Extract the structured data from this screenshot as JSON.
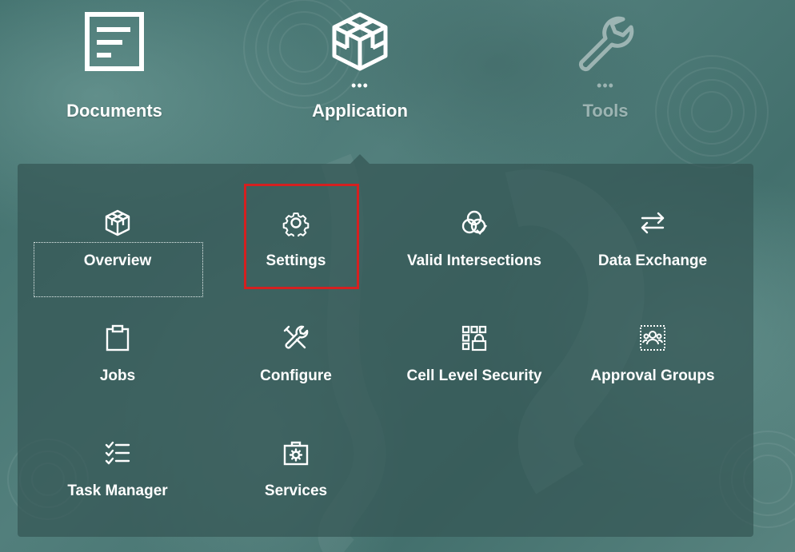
{
  "topnav": [
    {
      "label": "Documents",
      "icon": "document-icon",
      "has_more": false
    },
    {
      "label": "Application",
      "icon": "cube-icon",
      "has_more": true,
      "dots": "•••"
    },
    {
      "label": "Tools",
      "icon": "wrench-icon",
      "has_more": true,
      "dots": "•••"
    }
  ],
  "panel": {
    "tiles": [
      {
        "label": "Overview",
        "icon": "cube-icon"
      },
      {
        "label": "Settings",
        "icon": "gear-icon"
      },
      {
        "label": "Valid Intersections",
        "icon": "intersections-icon"
      },
      {
        "label": "Data Exchange",
        "icon": "exchange-arrows-icon"
      },
      {
        "label": "Jobs",
        "icon": "clipboard-icon"
      },
      {
        "label": "Configure",
        "icon": "tools-icon"
      },
      {
        "label": "Cell Level Security",
        "icon": "cell-security-icon"
      },
      {
        "label": "Approval Groups",
        "icon": "approval-groups-icon"
      },
      {
        "label": "Task Manager",
        "icon": "task-list-icon"
      },
      {
        "label": "Services",
        "icon": "services-toolbox-icon"
      }
    ],
    "focused_tile": "Overview",
    "highlighted_tile": "Settings"
  },
  "colors": {
    "background": "#4a7774",
    "panel": "#345654",
    "highlight": "#d52020",
    "text": "#ffffff"
  }
}
